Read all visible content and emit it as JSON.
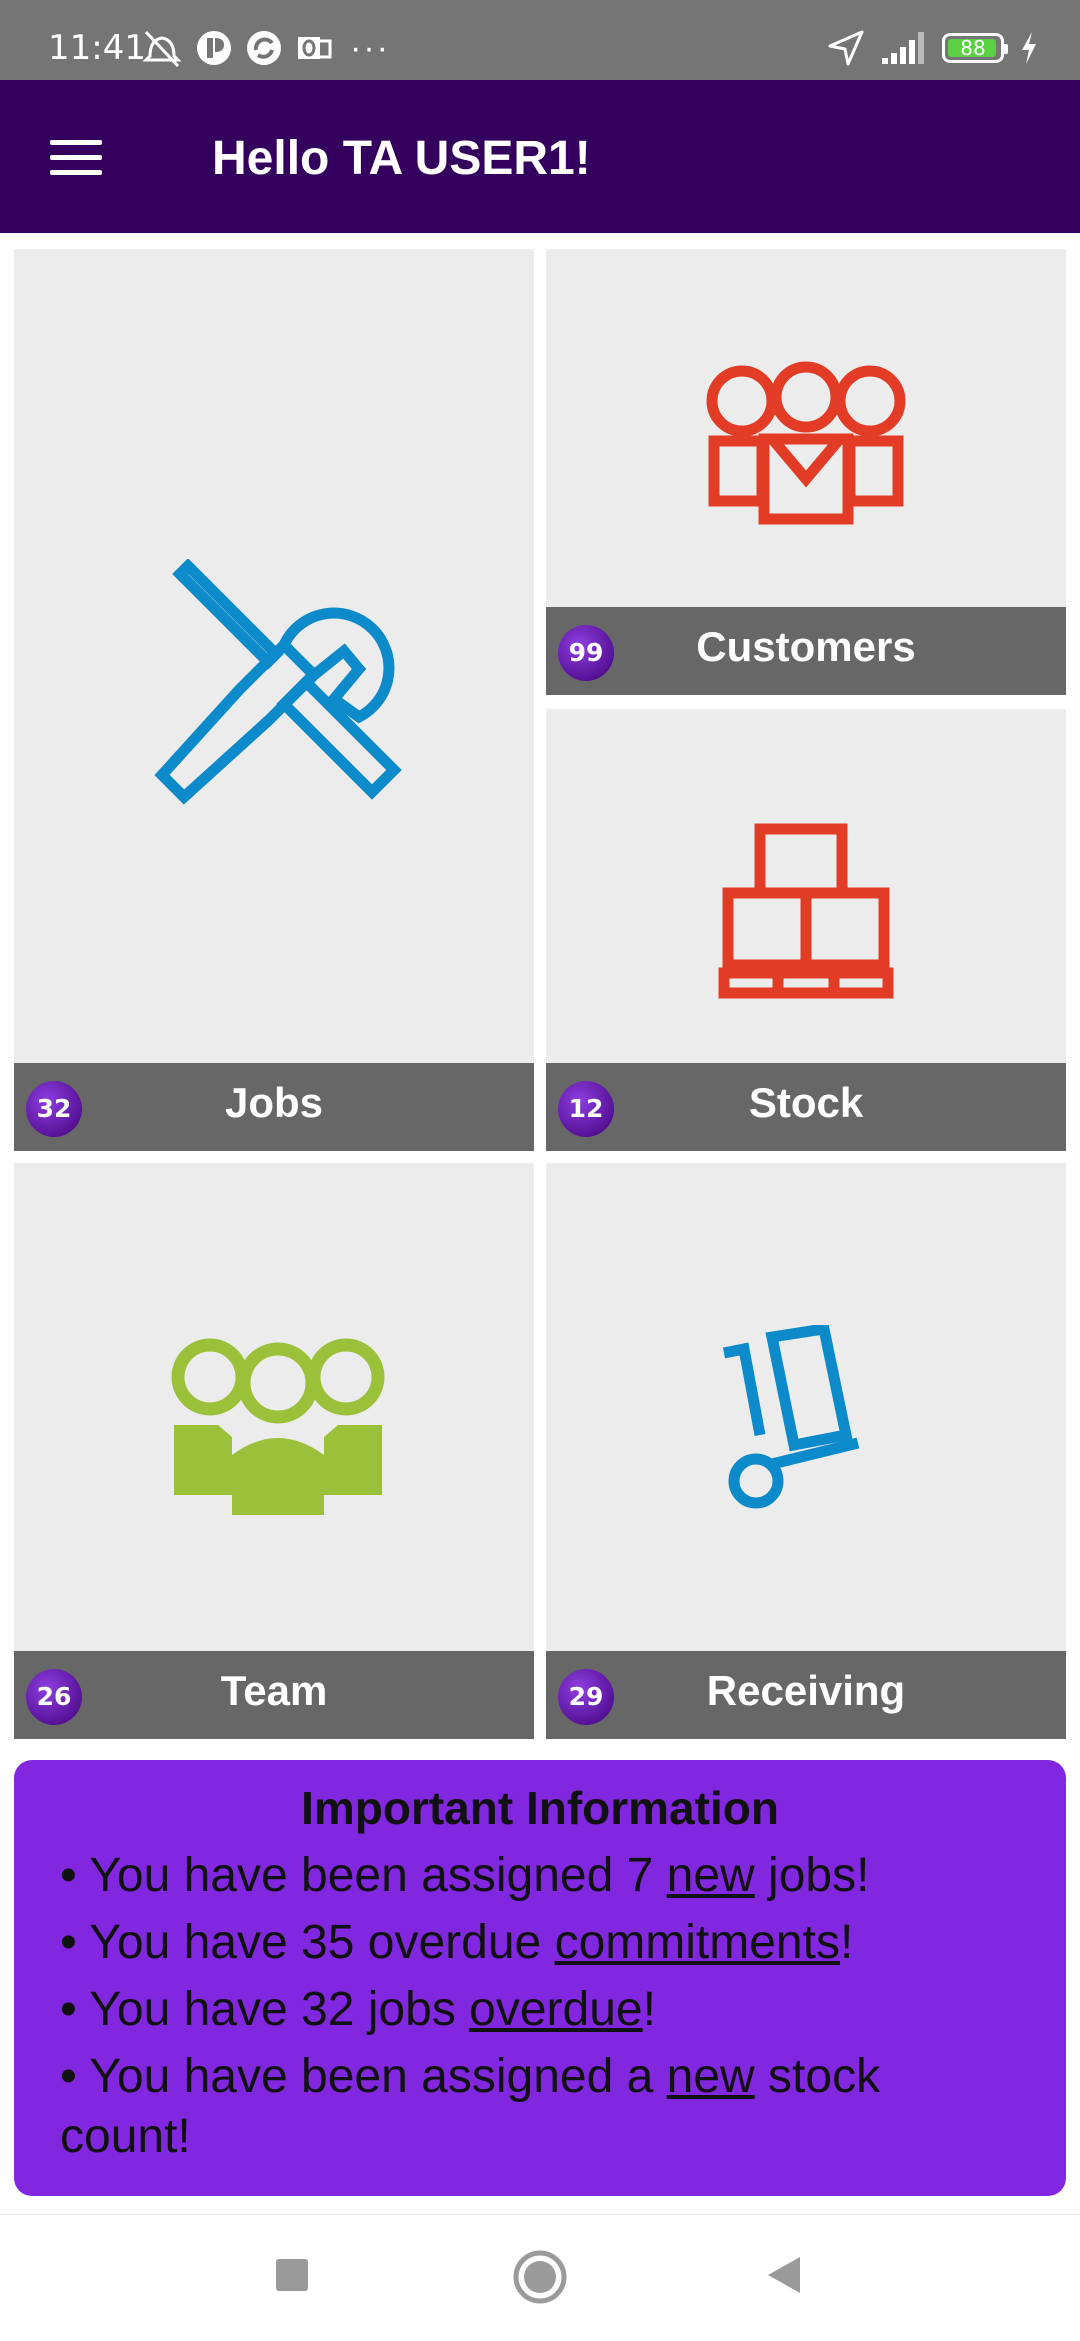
{
  "status_bar": {
    "time": "11:41",
    "battery_level": "88",
    "more": "···"
  },
  "app_bar": {
    "title": "Hello TA USER1!"
  },
  "tiles": [
    {
      "label": "Jobs",
      "badge": "32",
      "icon": "wrench-screwdriver-icon",
      "icon_color": "#0c8ac9"
    },
    {
      "label": "Customers",
      "badge": "99",
      "icon": "customers-group-icon",
      "icon_color": "#e23b26"
    },
    {
      "label": "Stock",
      "badge": "12",
      "icon": "boxes-pallet-icon",
      "icon_color": "#e23b26"
    },
    {
      "label": "Team",
      "badge": "26",
      "icon": "team-group-icon",
      "icon_color": "#9bc13b"
    },
    {
      "label": "Receiving",
      "badge": "29",
      "icon": "hand-truck-icon",
      "icon_color": "#0c8ac9"
    }
  ],
  "info": {
    "title": "Important Information",
    "items": [
      {
        "prefix": "• You have been assigned 7 ",
        "link": "new",
        "suffix": " jobs!"
      },
      {
        "prefix": "• You have 35 overdue ",
        "link": "commitments",
        "suffix": "!"
      },
      {
        "prefix": "• You have 32 jobs ",
        "link": "overdue",
        "suffix": "!"
      },
      {
        "prefix": "• You have been assigned a ",
        "link": "new",
        "suffix": " stock count!"
      }
    ]
  },
  "colors": {
    "app_bar": "#34005e",
    "info_card": "#8127e0",
    "badge": "#5a10a8",
    "tile_footer": "#676767",
    "tile_bg": "#ececec"
  }
}
